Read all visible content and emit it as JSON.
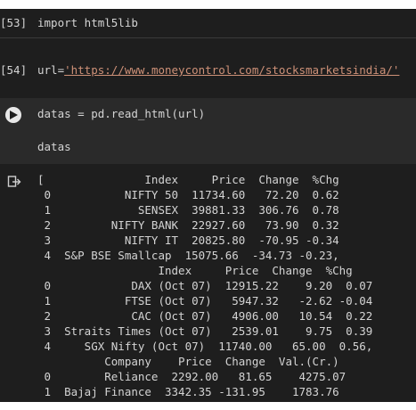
{
  "cells": {
    "c53": {
      "prompt": "[53]",
      "code": "import html5lib"
    },
    "c54": {
      "prompt": "[54]",
      "code_prefix": "url=",
      "code_string": "'https://www.moneycontrol.com/stocksmarketsindia/'"
    },
    "c55": {
      "line1": "datas = pd.read_html(url)",
      "line2": "datas"
    }
  },
  "output": {
    "lines": [
      "[               Index     Price  Change  %Chg",
      " 0           NIFTY 50  11734.60   72.20  0.62",
      " 1             SENSEX  39881.33  306.76  0.78",
      " 2         NIFTY BANK  22927.60   73.90  0.32",
      " 3           NIFTY IT  20825.80  -70.95 -0.34",
      " 4  S&P BSE Smallcap  15075.66  -34.73 -0.23,",
      "                  Index     Price  Change  %Chg",
      " 0            DAX (Oct 07)  12915.22    9.20  0.07",
      " 1           FTSE (Oct 07)   5947.32   -2.62 -0.04",
      " 2            CAC (Oct 07)   4906.00   10.54  0.22",
      " 3  Straits Times (Oct 07)   2539.01    9.75  0.39",
      " 4     SGX Nifty (Oct 07)  11740.00   65.00  0.56,",
      "          Company    Price  Change  Val.(Cr.)",
      " 0        Reliance  2292.00   81.65    4275.07",
      " 1  Bajaj Finance  3342.35 -131.95    1783.76"
    ]
  }
}
